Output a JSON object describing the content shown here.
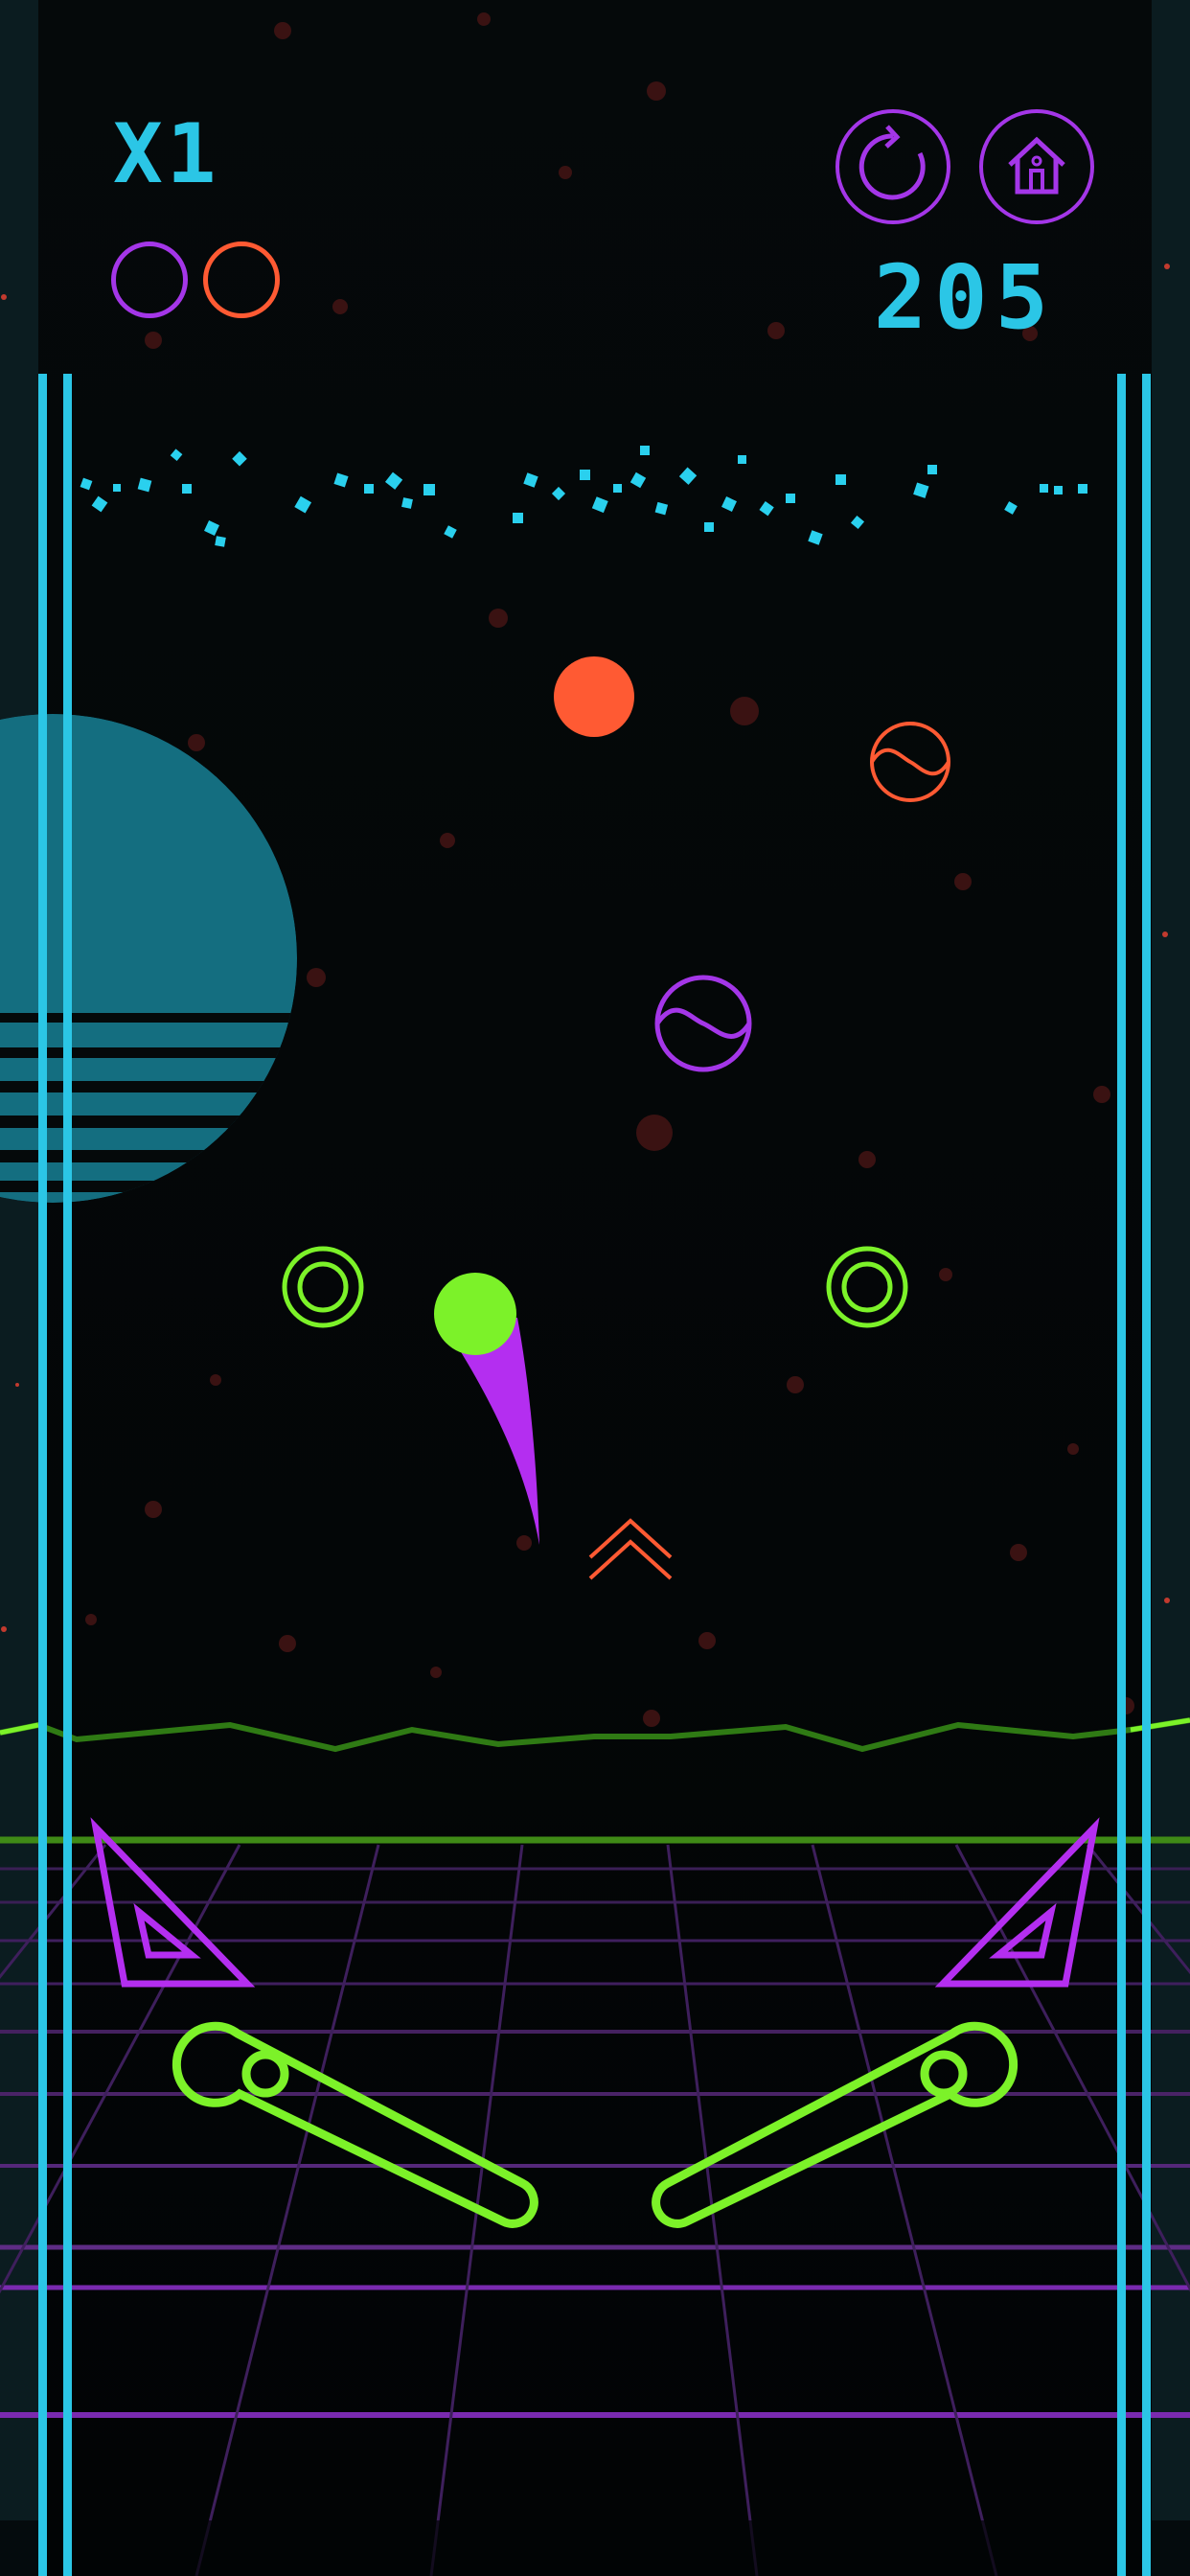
{
  "hud": {
    "multiplier": "X1",
    "score": "205",
    "lives": [
      {
        "color": "#a436e8"
      },
      {
        "color": "#ff5a33"
      }
    ]
  },
  "buttons": {
    "restart": "restart-icon",
    "home": "home-icon"
  },
  "colors": {
    "cyan": "#2bc6e6",
    "purple": "#a436e8",
    "orange": "#ff5a33",
    "green": "#7cf229",
    "background": "#030708"
  }
}
